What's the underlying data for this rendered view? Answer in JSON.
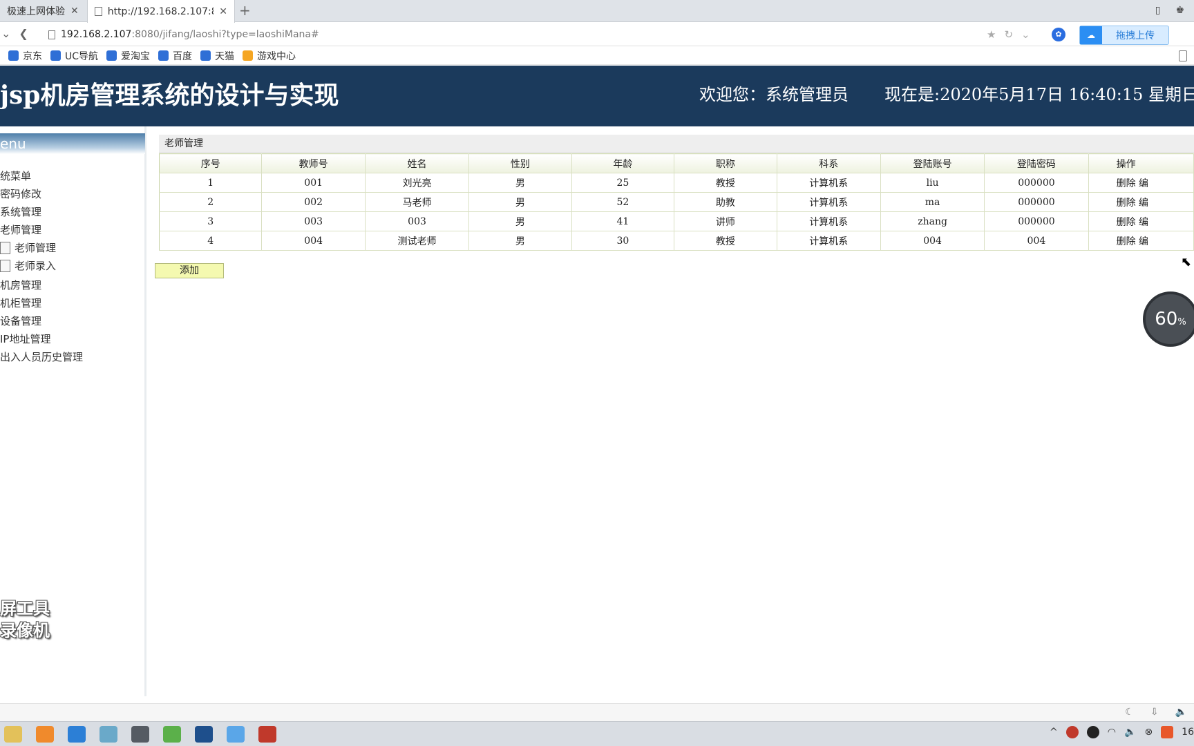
{
  "browser": {
    "tabs": [
      {
        "title": "极速上网体验"
      },
      {
        "title": "http://192.168.2.107:8"
      }
    ],
    "url_host": "192.168.2.107",
    "url_path": ":8080/jifang/laoshi?type=laoshiMana#",
    "upload_label": "拖拽上传",
    "bookmarks": [
      "京东",
      "UC导航",
      "爱淘宝",
      "百度",
      "天猫",
      "游戏中心"
    ],
    "new_tab_glyph": "+",
    "close_glyph": "✕"
  },
  "header": {
    "title": "jsp机房管理系统的设计与实现",
    "welcome": "欢迎您：系统管理员",
    "clock": "现在是:2020年5月17日 16:40:15 星期日"
  },
  "sidebar": {
    "menu_title": "enu",
    "items": [
      {
        "label": "统菜单"
      },
      {
        "label": "密码修改"
      },
      {
        "label": "系统管理"
      },
      {
        "label": "老师管理"
      },
      {
        "label": "老师管理"
      },
      {
        "label": "老师录入"
      },
      {
        "label": "机房管理"
      },
      {
        "label": "机柜管理"
      },
      {
        "label": "设备管理"
      },
      {
        "label": "IP地址管理"
      },
      {
        "label": "出入人员历史管理"
      }
    ],
    "watermark_line1": "屏工具",
    "watermark_line2": "录像机"
  },
  "main": {
    "panel_title": "老师管理",
    "columns": [
      "序号",
      "教师号",
      "姓名",
      "性别",
      "年龄",
      "职称",
      "科系",
      "登陆账号",
      "登陆密码",
      "操作"
    ],
    "rows": [
      [
        "1",
        "001",
        "刘光亮",
        "男",
        "25",
        "教授",
        "计算机系",
        "liu",
        "000000",
        "删除 编"
      ],
      [
        "2",
        "002",
        "马老师",
        "男",
        "52",
        "助教",
        "计算机系",
        "ma",
        "000000",
        "删除 编"
      ],
      [
        "3",
        "003",
        "003",
        "男",
        "41",
        "讲师",
        "计算机系",
        "zhang",
        "000000",
        "删除 编"
      ],
      [
        "4",
        "004",
        "测试老师",
        "男",
        "30",
        "教授",
        "计算机系",
        "004",
        "004",
        "删除 编"
      ]
    ],
    "add_label": "添加"
  },
  "overlay": {
    "speed_value": "60",
    "speed_unit": "%"
  },
  "taskbar": {
    "clock_fragment": "16"
  }
}
